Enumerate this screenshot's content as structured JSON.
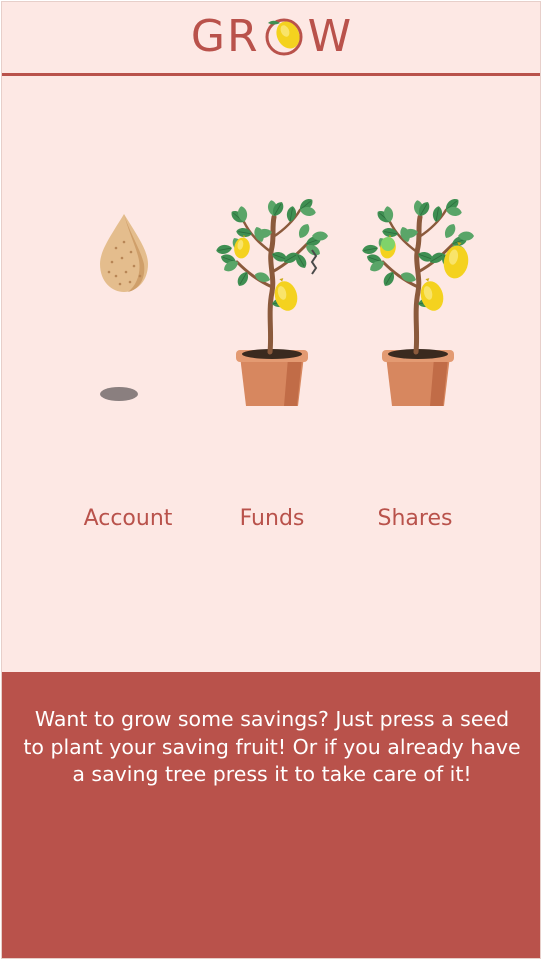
{
  "header": {
    "logo_left": "GR",
    "logo_right": "W",
    "logo_icon": "lemon-icon"
  },
  "plants": [
    {
      "label": "Account",
      "stage": "seed",
      "icon": "seed-icon"
    },
    {
      "label": "Funds",
      "stage": "tree",
      "icon": "lemon-tree-icon"
    },
    {
      "label": "Shares",
      "stage": "tree",
      "icon": "lemon-tree-icon"
    }
  ],
  "info": {
    "message": "Want to grow some savings? Just press a seed to plant your saving fruit! Or if you already have a saving tree press it to take care of it!"
  },
  "colors": {
    "brand": "#b9524b",
    "background": "#fde8e4",
    "lemon": "#f4d21f",
    "leaf": "#3f8f52",
    "pot": "#d7875f"
  }
}
